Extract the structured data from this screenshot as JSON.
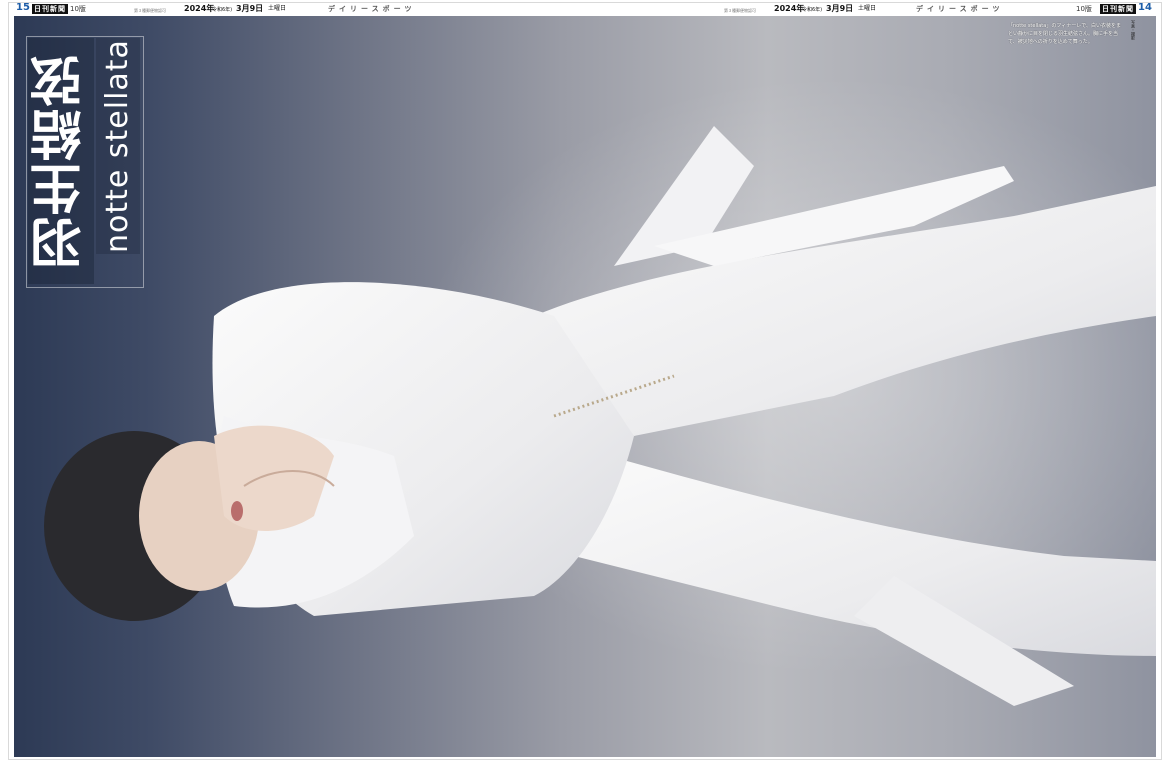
{
  "header": {
    "left_page_number": "15",
    "left_badge": "日刊新聞",
    "left_edition": "10版",
    "left_tiny": "第３種郵便物認可",
    "left_date": "2024年",
    "left_date_era": "(令和6年)",
    "left_date_day": "3月9日",
    "left_weekday": "土曜日",
    "left_masthead": "デイリースポーツ",
    "right_tiny": "第３種郵便物認可",
    "right_date": "2024年",
    "right_date_era": "(令和6年)",
    "right_date_day": "3月9日",
    "right_weekday": "土曜日",
    "right_masthead": "デイリースポーツ",
    "right_edition": "10版",
    "right_badge": "日刊新聞",
    "right_page_number": "14"
  },
  "feature": {
    "title_jp": "羽生結弦",
    "title_en": "notte stellata"
  },
  "caption": {
    "text": "「notte stellata」のフィナーレで、白い衣装をまとい静かに目を閉じる羽生結弦さん。胸に手を当て、被災地への祈りを込めて舞った。"
  },
  "side_note": {
    "text": "写真・撮影"
  },
  "colors": {
    "page_number": "#1d5da8",
    "badge_bg": "#111111",
    "title_text": "#ffffff"
  }
}
